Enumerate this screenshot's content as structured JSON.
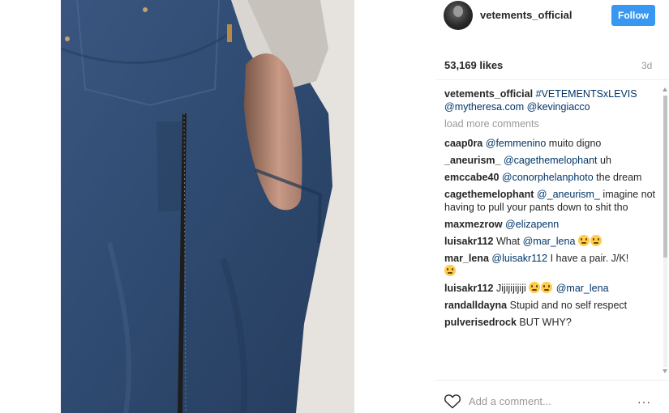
{
  "post": {
    "username": "vetements_official",
    "follow_label": "Follow",
    "likes": "53,169 likes",
    "time": "3d",
    "caption": {
      "user": "vetements_official",
      "text_mentions": [
        "#VETEMENTSxLEVIS",
        "@mytheresa.com",
        "@kevingiacco"
      ]
    },
    "load_more": "load more comments"
  },
  "comments": [
    {
      "user": "caap0ra",
      "mention": "@femmenino",
      "text": " muito digno"
    },
    {
      "user": "_aneurism_",
      "mention": "@cagethemelophant",
      "text": " uh"
    },
    {
      "user": "emccabe40",
      "mention": "@conorphelanphoto",
      "text": " the dream"
    },
    {
      "user": "cagethemelophant",
      "mention": "@_aneurism_",
      "text": " imagine not having to pull your pants down to shit tho"
    },
    {
      "user": "maxmezrow",
      "mention": "@elizapenn",
      "text": ""
    },
    {
      "user": "luisakr112",
      "pre": "What ",
      "mention": "@mar_lena",
      "text": ""
    },
    {
      "user": "mar_lena",
      "mention": "@luisakr112",
      "text": " I have a pair. J/K!"
    },
    {
      "user": "luisakr112",
      "pre": "Jijijijijiji ",
      "mention": "@mar_lena",
      "text": ""
    },
    {
      "user": "randalldayna",
      "text": "Stupid and no self respect"
    },
    {
      "user": "pulverisedrock",
      "text": "BUT WHY?"
    }
  ],
  "footer": {
    "add_comment_placeholder": "Add a comment...",
    "more_label": "···"
  },
  "icons": {
    "avatar": "avatar",
    "heart": "heart-icon",
    "emoji": "grimace-emoji-icon",
    "more": "more-options-icon"
  },
  "colors": {
    "follow_button": "#3897f0",
    "mention": "#003569",
    "muted": "#999999"
  }
}
